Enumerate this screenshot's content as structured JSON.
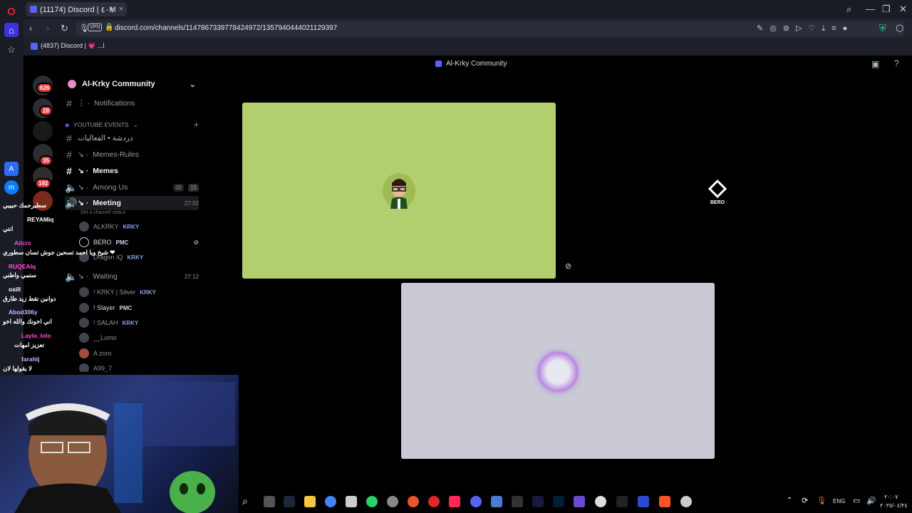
{
  "browser": {
    "tab_title": "(11174) Discord | ٤٠M",
    "tab_new_symbol": "+",
    "url": "discord.com/channels/1147867339778424972/1357940444021129397",
    "vpn_label": "VPN",
    "bookmark_label": "(4837) Discord | 💗 ...l"
  },
  "discord": {
    "window_title": "Al-Krky Community",
    "server_name": "Al-Krky Community",
    "server_badges": [
      "626",
      "28",
      "35",
      "192"
    ],
    "channels": [
      {
        "name": "Notifications",
        "type": "text",
        "prefix": "⋮ ·"
      },
      {
        "name": "YOUTUBE EVENTS",
        "type": "category"
      },
      {
        "name": "دردشة • الفعاليات",
        "type": "text"
      },
      {
        "name": "Memes-Rules",
        "type": "text",
        "prefix": "↘ ·"
      },
      {
        "name": "Memes",
        "type": "text",
        "prefix": "↘ ·",
        "active": true
      },
      {
        "name": "Among Us",
        "type": "voice",
        "prefix": "↘ ·",
        "counts": [
          "00",
          "15"
        ]
      },
      {
        "name": "Meeting",
        "type": "voice",
        "prefix": "↘ ·",
        "time": "27:02",
        "status": "Set a channel status"
      },
      {
        "name": "Waiting",
        "type": "voice",
        "prefix": "↘ ·",
        "time": "27:12"
      }
    ],
    "meeting_users": [
      {
        "name": "ALKRKY",
        "tag": "KRKY"
      },
      {
        "name": "BERO",
        "tag": "PMC"
      },
      {
        "name": "Dragon IQ",
        "tag": "KRKY"
      }
    ],
    "waiting_users": [
      {
        "name": "! KRKY | Silver",
        "tag": "KRKY"
      },
      {
        "name": "! Slayer",
        "tag": "PMC"
      },
      {
        "name": "! SALAH",
        "tag": "KRKY"
      },
      {
        "name": "__Lumo",
        "tag": ""
      },
      {
        "name": "A zoro",
        "tag": ""
      },
      {
        "name": "A99_7",
        "tag": ""
      }
    ],
    "stage_side_label": "BERO"
  },
  "chat_overlay": [
    {
      "user": "",
      "text": "سطيرحمك حبيبي",
      "color": "#ffffff"
    },
    {
      "user": "REYAMiq",
      "text": "",
      "color": "#ffffff"
    },
    {
      "user": "",
      "text": "انتي",
      "color": "#ffffff"
    },
    {
      "user": "Ailcrs",
      "text": "",
      "color": "#ff4fd8"
    },
    {
      "user": "",
      "text": "شيخ ويا احمد تسحين جوش تسان سطوري ❤",
      "color": "#ffffff"
    },
    {
      "user": "RUQEAIq",
      "text": "",
      "color": "#ff4fd8"
    },
    {
      "user": "",
      "text": "ستمي واطني",
      "color": "#ffffff"
    },
    {
      "user": "oxill",
      "text": "",
      "color": "#ffffff"
    },
    {
      "user": "",
      "text": "دوانين نقط زيد طارق",
      "color": "#ffffff"
    },
    {
      "user": "Abod306y",
      "text": "",
      "color": "#c8b6ff"
    },
    {
      "user": "",
      "text": "اني اخونك والله اخو",
      "color": "#ffffff"
    },
    {
      "user": "Layla_lolo",
      "text": "",
      "color": "#ff4fd8"
    },
    {
      "user": "",
      "text": "تعزيز امهات",
      "color": "#ffffff"
    },
    {
      "user": "farahlj",
      "text": "",
      "color": "#c8b6ff"
    },
    {
      "user": "",
      "text": "لا يقولها لان",
      "color": "#ffffff"
    }
  ],
  "taskbar": {
    "lang": "ENG",
    "time": "٢٠:٠٧",
    "date": "٢٠٢٥/٠٤/٢٤"
  },
  "colors": {
    "tile_green": "#b2ce6e",
    "tile_gray": "#c9cad4",
    "badge_red": "#da373c",
    "opera_red": "#e0262c"
  }
}
